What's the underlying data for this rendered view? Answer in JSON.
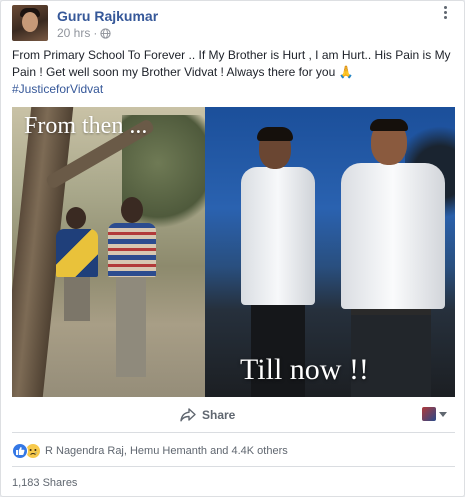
{
  "post": {
    "author": "Guru Rajkumar",
    "time": "20 hrs",
    "text_line1": "From Primary School To Forever .. If My Brother is Hurt , I am Hurt.. His Pain is",
    "text_line2": "My Pain ! Get well soon my Brother Vidvat ! Always there for you",
    "pray_emoji": "🙏",
    "hashtag": "#JusticeforVidvat"
  },
  "photo": {
    "caption_then": "From then ...",
    "caption_now": "Till now !!"
  },
  "actions": {
    "share_label": "Share"
  },
  "reactions": {
    "icons": [
      "like-icon",
      "sad-icon"
    ],
    "summary": "R Nagendra Raj, Hemu Hemanth and 4.4K others"
  },
  "stats": {
    "shares": "1,183 Shares"
  },
  "colors": {
    "link": "#365899",
    "meta": "#90949c",
    "like_blue": "#3578e5",
    "sad_yellow": "#f7c94b"
  }
}
